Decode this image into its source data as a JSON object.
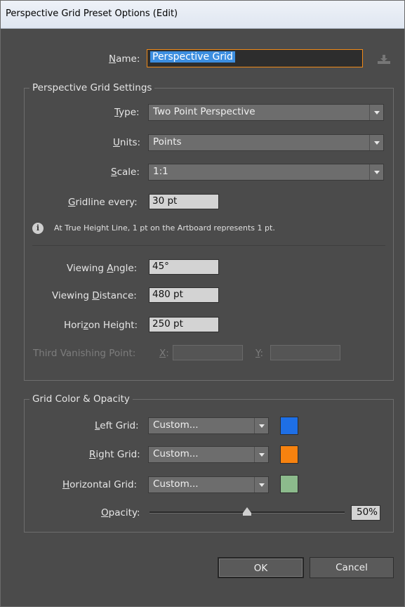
{
  "window": {
    "title": "Perspective Grid Preset Options (Edit)"
  },
  "name": {
    "label": "Name:",
    "value": "Perspective Grid"
  },
  "settings": {
    "group_title": "Perspective Grid Settings",
    "type_label": "Type:",
    "type_value": "Two Point Perspective",
    "units_label": "Units:",
    "units_value": "Points",
    "scale_label": "Scale:",
    "scale_value": "1:1",
    "gridline_label": "Gridline every:",
    "gridline_value": "30 pt",
    "info_text": "At True Height Line, 1 pt on the Artboard represents 1 pt.",
    "viewing_angle_label": "Viewing Angle:",
    "viewing_angle_value": "45°",
    "viewing_distance_label": "Viewing Distance:",
    "viewing_distance_value": "480 pt",
    "horizon_height_label": "Horizon Height:",
    "horizon_height_value": "250 pt",
    "third_vp_label": "Third Vanishing Point:",
    "x_label": "X:",
    "y_label": "Y:"
  },
  "color": {
    "group_title": "Grid Color & Opacity",
    "left_label": "Left Grid:",
    "left_value": "Custom...",
    "left_color": "#1e6fe6",
    "right_label": "Right Grid:",
    "right_value": "Custom...",
    "right_color": "#f7820f",
    "horizontal_label": "Horizontal Grid:",
    "horizontal_value": "Custom...",
    "horizontal_color": "#8cbb8c",
    "opacity_label": "Opacity:",
    "opacity_value": "50%",
    "opacity_fraction": 0.5
  },
  "buttons": {
    "ok": "OK",
    "cancel": "Cancel"
  },
  "icons": {
    "info": "info-icon",
    "import": "import-icon",
    "dropdown": "chevron-down-icon"
  }
}
